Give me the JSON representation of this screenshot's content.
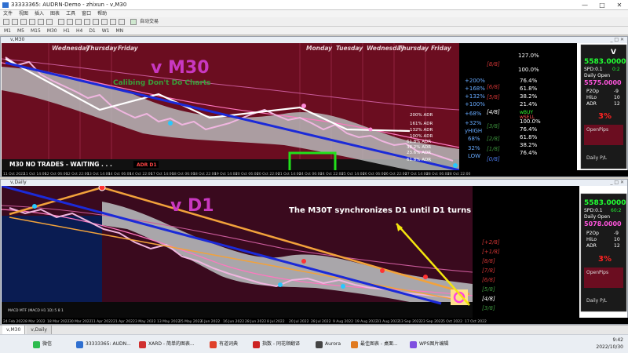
{
  "window": {
    "title": "33333365: AUDRN-Demo - zhixun - v,M30",
    "controls": [
      "—",
      "□",
      "✕"
    ]
  },
  "menu": [
    "文件",
    "视图",
    "插入",
    "图表",
    "工具",
    "窗口",
    "帮助"
  ],
  "toolbar": {
    "autotrade_label": "自动交易"
  },
  "timeframes": [
    "M1",
    "M5",
    "M15",
    "M30",
    "H1",
    "H4",
    "D1",
    "W1",
    "MN"
  ],
  "m30": {
    "window_title": "v,M30",
    "big_label": "v M30",
    "subtitle": "Calibing Don't Do Charts",
    "day_labels": [
      "Wednesday",
      "Thursday",
      "Friday",
      "Monday",
      "Tuesday",
      "Wednesday",
      "Thursday",
      "Friday",
      "Monday",
      "Tuesday",
      "Wednesday",
      "Thursday",
      "Friday"
    ],
    "status_text": "M30  NO TRADES - WAITING . . .",
    "adr_tag": "ADR D1",
    "fib_levels": [
      "[8/8]",
      "[7/8]",
      "[6/8]",
      "[5/8]",
      "[4/8]",
      "[3/8]",
      "[2/8]",
      "[1/8]",
      "[0/8]"
    ],
    "percent_left": [
      "+200%",
      "+168%",
      "+132%",
      "+100%",
      "+68%",
      "+32%",
      "yHIGH",
      "68%",
      "32%",
      "LOW"
    ],
    "percent_right": [
      "127.0%",
      "100.0%",
      "76.4%",
      "61.8%",
      "38.2%",
      "21.4%",
      "100.0%",
      "76.4%",
      "61.8%",
      "38.2%",
      "76.4%"
    ],
    "labels": [
      "wBUY",
      "wSELL",
      "200% ADR",
      "161% ADR",
      "132% ADR",
      "100% ADR",
      "61.8% ADR",
      "38.2% ADR",
      "23.6% ADR",
      "61.8% ADR"
    ],
    "x_axis": [
      "11 Oct 2022",
      "11 Oct 14:00",
      "12 Oct 06:00",
      "12 Oct 22:00",
      "13 Oct 14:00",
      "14 Oct 06:00",
      "14 Oct 22:00",
      "17 Oct 14:00",
      "18 Oct 06:00",
      "18 Oct 22:00",
      "19 Oct 14:00",
      "20 Oct 06:00",
      "20 Oct 22:00",
      "21 Oct 14:00",
      "24 Oct 06:00",
      "24 Oct 22:00",
      "25 Oct 14:00",
      "26 Oct 06:00",
      "26 Oct 22:00",
      "27 Oct 14:00",
      "28 Oct 06:00",
      "28 Oct 22:00"
    ],
    "y_axis": [
      "0.6350",
      "0.6315",
      "0.6280",
      "0.6245",
      "0.6210",
      "0.6175",
      "0.6140",
      "0.6105",
      "0.6070",
      "0.6035",
      "0.6000",
      "0.5965"
    ],
    "info": {
      "price": "5583.0000",
      "spd": "SPD:0.1",
      "ratio": "0:2",
      "daily_open": "Daily Open",
      "daily_val": "5575.0000",
      "p2op": "P2Op",
      "p2op_v": "-9",
      "hilo": "HiLo",
      "hilo_v": "10",
      "adr": "ADR",
      "adr_v": "12",
      "pct": "3%",
      "open_pips": "OpenPips",
      "daily_pl": "Daily P/L"
    }
  },
  "d1": {
    "window_title": "v,Daily",
    "big_label": "v D1",
    "annotation": "The M30T synchronizes D1 until D1 turns dark or green",
    "fib_levels": [
      "[+2/8]",
      "[+1/8]",
      "[8/8]",
      "[7/8]",
      "[6/8]",
      "[5/8]",
      "[4/8]",
      "[3/8]"
    ],
    "x_axis": [
      "24 Feb 2022",
      "8 Mar 2022",
      "18 Mar 2022",
      "30 Mar 2022",
      "11 Apr 2022",
      "21 Apr 2022",
      "3 May 2022",
      "13 May 2022",
      "25 May 2022",
      "6 Jun 2022",
      "16 Jun 2022",
      "28 Jun 2022",
      "8 Jul 2022",
      "20 Jul 2022",
      "28 Jul 2022",
      "9 Aug 2022",
      "19 Aug 2022",
      "31 Aug 2022",
      "13 Sep 2022",
      "23 Sep 2022",
      "5 Oct 2022",
      "17 Oct 2022"
    ],
    "y_axis": [
      "0.7245",
      "0.7150",
      "0.7055",
      "0.6960",
      "0.6865",
      "0.6770",
      "0.6675",
      "0.6580",
      "0.6485",
      "0.6390",
      "0.6295",
      "0.6200",
      "0.6105",
      "0.6010",
      "0.5915"
    ],
    "macd_label": "MACD MTF (MACD H1 1D) 5 8 1",
    "info": {
      "price": "5583.0000",
      "spd": "SPD:0.1",
      "ratio": "60:2",
      "daily_open": "Daily Open",
      "daily_val": "5078.0000",
      "p2op": "P2Op",
      "p2op_v": "-9",
      "hilo": "HiLo",
      "hilo_v": "10",
      "adr": "ADR",
      "adr_v": "12",
      "pct": "3%",
      "open_pips": "OpenPips",
      "daily_pl": "Daily P/L"
    }
  },
  "chart_tabs": [
    "v,M30",
    "v,Daily"
  ],
  "taskbar": {
    "items": [
      "微信",
      "33333365: AUDN...",
      "XARD - 简单的图表...",
      "有道词典",
      "指数 - 同花顺翻译",
      "Aurora",
      "最佳图表 - 桌面...",
      "WPS图片编辑"
    ],
    "time": "9:42",
    "date": "2022/10/30"
  },
  "colors": {
    "chart_bg": "#000000",
    "panel_maroon": "#6b0d20",
    "band": "#b6b7b9",
    "trend_blue": "#1b2ad8",
    "trend_white": "#ffffff",
    "trend_orange": "#f2a23b",
    "annotation_yellow": "#f4e60e",
    "highlight_green": "#22e01b",
    "info_green": "#22ff33"
  }
}
